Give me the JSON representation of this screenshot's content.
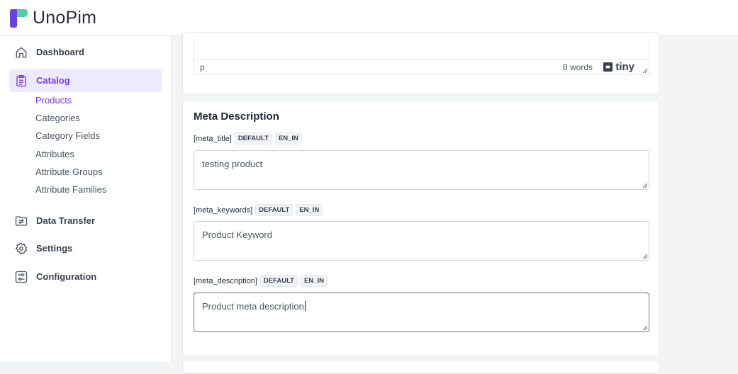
{
  "app": {
    "name": "UnoPim"
  },
  "sidebar": {
    "items": [
      {
        "label": "Dashboard",
        "icon": "home-icon"
      },
      {
        "label": "Catalog",
        "icon": "clipboard-icon",
        "active": true
      },
      {
        "label": "Data Transfer",
        "icon": "folder-transfer-icon"
      },
      {
        "label": "Settings",
        "icon": "gear-icon"
      },
      {
        "label": "Configuration",
        "icon": "sliders-icon"
      }
    ],
    "catalog_sub": [
      {
        "label": "Products",
        "active": true
      },
      {
        "label": "Categories"
      },
      {
        "label": "Category Fields"
      },
      {
        "label": "Attributes"
      },
      {
        "label": "Attribute Groups"
      },
      {
        "label": "Attribute Families"
      }
    ]
  },
  "editor": {
    "path": "p",
    "word_count": "8 words",
    "brand": "tiny"
  },
  "meta": {
    "title": "Meta Description",
    "fields": [
      {
        "label": "[meta_title]",
        "tags": [
          "DEFAULT",
          "EN_IN"
        ],
        "value": "testing product"
      },
      {
        "label": "[meta_keywords]",
        "tags": [
          "DEFAULT",
          "EN_IN"
        ],
        "value": "Product Keyword"
      },
      {
        "label": "[meta_description]",
        "tags": [
          "DEFAULT",
          "EN_IN"
        ],
        "value": "Product meta description",
        "focused": true
      }
    ]
  },
  "colors": {
    "accent": "#7c3aed",
    "accent_bg": "#ede9fe",
    "logo_green": "#4fd1a5",
    "logo_purple": "#6d3ee0"
  }
}
